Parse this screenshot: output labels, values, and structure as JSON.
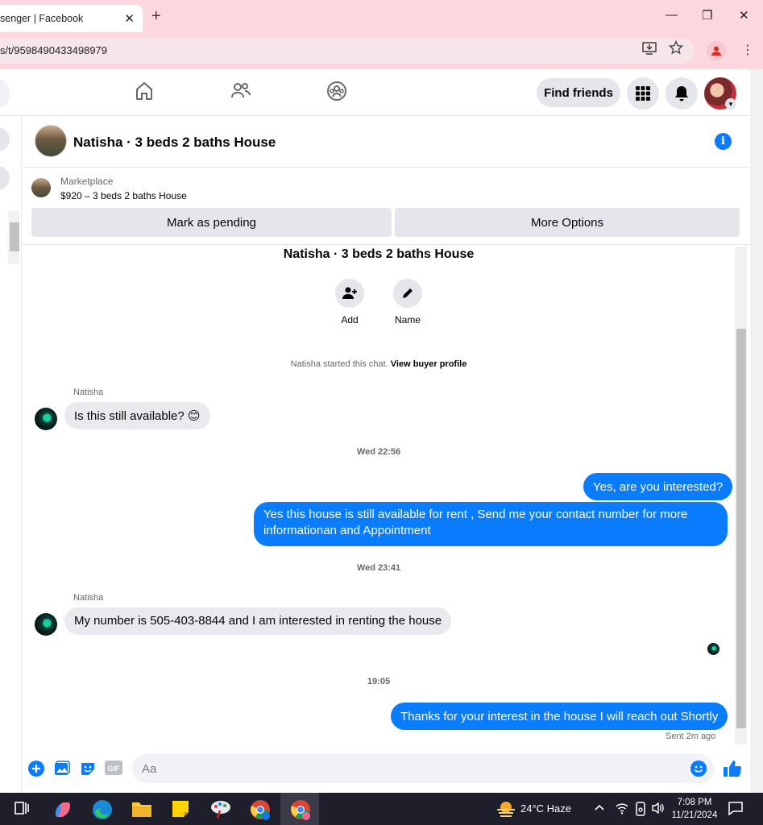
{
  "browser": {
    "tab_title": "senger | Facebook",
    "tab_close": "✕",
    "new_tab": "+",
    "url": "s/t/9598490433498979",
    "minimize": "—",
    "maximize": "❐",
    "close": "✕"
  },
  "nav": {
    "find_friends": "Find friends"
  },
  "chat": {
    "title": "Natisha · 3 beds 2 baths House",
    "info": "i"
  },
  "marketplace": {
    "label": "Marketplace",
    "listing": "$920 – 3 beds 2 baths House",
    "mark_pending": "Mark as pending",
    "more_options": "More Options"
  },
  "conversation": {
    "title": "Natisha · 3 beds 2 baths House",
    "add_label": "Add",
    "name_label": "Name",
    "system_text": "Natisha started this chat.",
    "system_link": "View buyer profile",
    "messages": [
      {
        "sender": "Natisha",
        "text": "Is this still available? 😊",
        "direction": "in"
      },
      {
        "timestamp": "Wed 22:56"
      },
      {
        "text": "Yes, are you interested?",
        "direction": "out"
      },
      {
        "text": "Yes this house is still available for rent , Send me your contact number for more informationan and Appointment",
        "direction": "out"
      },
      {
        "timestamp": "Wed 23:41"
      },
      {
        "sender": "Natisha",
        "text": "My number is 505-403-8844 and I am interested in renting the house",
        "direction": "in"
      },
      {
        "timestamp": "19:05"
      },
      {
        "text": "Thanks for your interest in the house I will reach out Shortly",
        "direction": "out"
      }
    ],
    "sent_status": "Sent 2m ago"
  },
  "composer": {
    "placeholder": "Aa",
    "gif": "GIF"
  },
  "taskbar": {
    "weather": "24°C  Haze",
    "time": "7:08 PM",
    "date": "11/21/2024"
  },
  "colors": {
    "accent": "#0a7cff",
    "tab_strip": "#fcd7dd",
    "bubble_in": "#e9eaee"
  }
}
